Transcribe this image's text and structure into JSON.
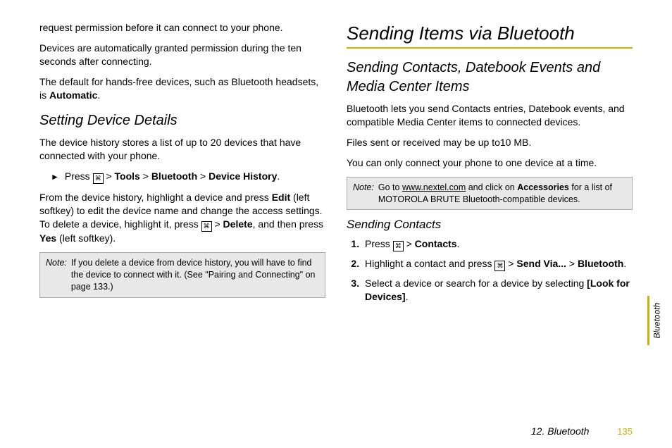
{
  "left": {
    "p1": "request permission before it can connect to your phone.",
    "p2": "Devices are automatically granted permission during the ten seconds after connecting.",
    "p3_pre": "The default for hands-free devices, such as Bluetooth headsets, is ",
    "p3_bold": "Automatic",
    "p3_post": ".",
    "h_setting": "Setting Device Details",
    "p4": "The device history stores a list of up to 20 devices that have connected with your phone.",
    "step_press": "Press ",
    "step_path1": "Tools",
    "step_path2": "Bluetooth",
    "step_path3": "Device History",
    "p5_a": "From the device history, highlight a device and press ",
    "p5_b": "Edit",
    "p5_c": " (left softkey) to edit the device name and change the access settings. To delete a device, highlight it, press ",
    "p5_d": "Delete",
    "p5_e": ", and then press ",
    "p5_f": "Yes",
    "p5_g": " (left softkey).",
    "note_label": "Note:",
    "note_body": "If you delete a device from device history, you will have to find the device to connect with it. (See \"Pairing and Connecting\" on page 133.)"
  },
  "right": {
    "h1": "Sending Items via Bluetooth",
    "h2": "Sending Contacts, Datebook Events and Media Center Items",
    "p1": "Bluetooth lets you send Contacts entries, Datebook events, and compatible Media Center items to connected devices.",
    "p2": "Files sent or received may be up to10 MB.",
    "p3": "You can only connect your phone to one device at a time.",
    "note_label": "Note:",
    "note_a": "Go to ",
    "note_link": "www.nextel.com",
    "note_b": " and click on ",
    "note_bold": "Accessories",
    "note_c": " for a list of MOTOROLA BRUTE Bluetooth-compatible devices.",
    "h3": "Sending Contacts",
    "s1_a": "Press ",
    "s1_b": "Contacts",
    "s2_a": "Highlight a contact and press ",
    "s2_b": "Send Via...",
    "s2_c": "Bluetooth",
    "s3_a": "Select a device or search for a device by selecting ",
    "s3_b": "[Look for Devices]"
  },
  "sidetab": "Bluetooth",
  "footer_section": "12. Bluetooth",
  "footer_page": "135",
  "gt": ">"
}
